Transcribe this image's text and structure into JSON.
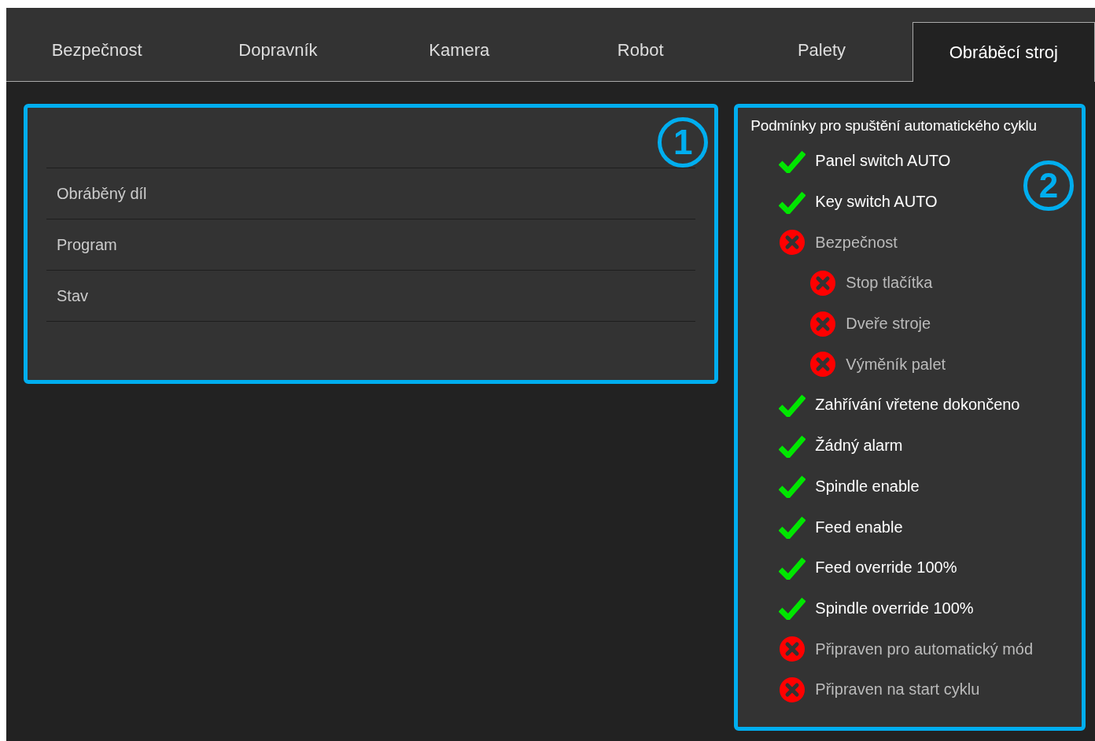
{
  "tabs": [
    {
      "label": "Bezpečnost",
      "selected": false
    },
    {
      "label": "Dopravník",
      "selected": false
    },
    {
      "label": "Kamera",
      "selected": false
    },
    {
      "label": "Robot",
      "selected": false
    },
    {
      "label": "Palety",
      "selected": false
    },
    {
      "label": "Obráběcí stroj",
      "selected": true
    }
  ],
  "info_panel": {
    "badge": "1",
    "rows": [
      {
        "label": "Obráběný díl"
      },
      {
        "label": "Program"
      },
      {
        "label": "Stav"
      }
    ]
  },
  "conditions_panel": {
    "title": "Podmínky pro spuštění automatického cyklu",
    "badge": "2",
    "items": [
      {
        "label": "Panel switch AUTO",
        "met": true
      },
      {
        "label": "Key switch AUTO",
        "met": true
      },
      {
        "label": "Bezpečnost",
        "met": false,
        "children": [
          {
            "label": "Stop tlačítka",
            "met": false
          },
          {
            "label": "Dveře stroje",
            "met": false
          },
          {
            "label": "Výměník palet",
            "met": false
          }
        ]
      },
      {
        "label": "Zahřívání vřetene dokončeno",
        "met": true
      },
      {
        "label": "Žádný alarm",
        "met": true
      },
      {
        "label": "Spindle enable",
        "met": true
      },
      {
        "label": "Feed enable",
        "met": true
      },
      {
        "label": "Feed override 100%",
        "met": true
      },
      {
        "label": "Spindle override 100%",
        "met": true
      },
      {
        "label": "Připraven pro automatický mód",
        "met": false
      },
      {
        "label": "Připraven na start cyklu",
        "met": false
      }
    ]
  }
}
